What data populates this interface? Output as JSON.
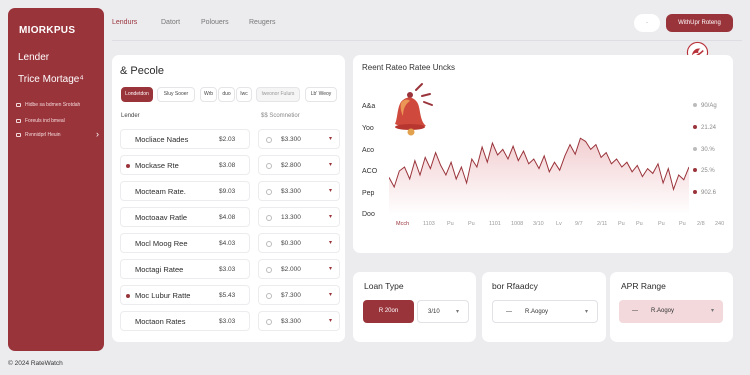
{
  "app": {
    "brand": "MIORKPUS",
    "footer": "© 2024 RateWatch"
  },
  "nav": {
    "tabs": [
      {
        "label": "Lendurs",
        "active": true
      },
      {
        "label": "Datort"
      },
      {
        "label": "Polouers"
      },
      {
        "label": "Reugers"
      }
    ],
    "toggle_label": "·",
    "cta_label": "WithUpr Roteng"
  },
  "sidebar": {
    "title": "Lender",
    "subtitle": "Trice Mortage⁴",
    "items": [
      {
        "icon": "list-icon",
        "label": "Hidbe sa bdmen Srotdah"
      },
      {
        "icon": "wifi-icon",
        "label": "Foreuls ind bmeal"
      },
      {
        "icon": "card-icon",
        "label": "Rvnnidprl Heuin"
      }
    ]
  },
  "lenders": {
    "title": "& Pecole",
    "filters": [
      "Londetdon",
      "Sluy Sooer",
      "Wrb",
      "duo",
      "Iwc",
      "lweonor Fulurs",
      "Lb' Weoy"
    ],
    "col_lender": "Lender",
    "col_amount": "$$ Scomnetior",
    "rows": [
      {
        "name": "Mocliace Nades",
        "rate": "$2.03",
        "amount": "$3.300",
        "dot": false
      },
      {
        "name": "Mockase Rte",
        "rate": "$3.08",
        "amount": "$2.800",
        "dot": true
      },
      {
        "name": "Mocteam Rate.",
        "rate": "$9.03",
        "amount": "$3.300",
        "dot": false
      },
      {
        "name": "Moctoaav Ratle",
        "rate": "$4.08",
        "amount": "13.300",
        "dot": false
      },
      {
        "name": "Mocl Moog Ree",
        "rate": "$4.03",
        "amount": "$0.300",
        "dot": false
      },
      {
        "name": "Moctagi Ratee",
        "rate": "$3.03",
        "amount": "$2.000",
        "dot": false
      },
      {
        "name": "Moc Lubur Ratte",
        "rate": "$5.43",
        "amount": "$7.300",
        "dot": true
      },
      {
        "name": "Moctaon Rates",
        "rate": "$3.03",
        "amount": "$3.300",
        "dot": false
      }
    ]
  },
  "chart_data": {
    "type": "line",
    "title": "Reent Rateo Ratee Uncks",
    "y_labels": [
      "A&a",
      "Yoo",
      "Aco",
      "ACO",
      "Pep",
      "Doo"
    ],
    "x": [
      "Mcch",
      "1103",
      "Pu",
      "Pu",
      "1101",
      "1008",
      "3/10",
      "Lv",
      "9/7",
      "2/11",
      "Pu",
      "Pu",
      "Pu",
      "Pu",
      "2/8",
      "240"
    ],
    "legend": [
      {
        "label": "90/Ag",
        "color": "#bbbbbb"
      },
      {
        "label": "21.24",
        "color": "#9a343b"
      },
      {
        "label": "30.%",
        "color": "#bbbbbb"
      },
      {
        "label": "25.%",
        "color": "#9a343b"
      },
      {
        "label": "902.6",
        "color": "#9a343b"
      }
    ],
    "series": [
      {
        "values": [
          0.47,
          0.35,
          0.55,
          0.6,
          0.45,
          0.68,
          0.5,
          0.72,
          0.58,
          0.78,
          0.62,
          0.5,
          0.66,
          0.45,
          0.6,
          0.4,
          0.7,
          0.6,
          0.85,
          0.66,
          0.9,
          0.75,
          0.82,
          0.7,
          0.86,
          0.68,
          0.8,
          0.64,
          0.7,
          0.58,
          0.74,
          0.54,
          0.66,
          0.56,
          0.74,
          0.88,
          0.76,
          0.96,
          0.92,
          0.82,
          0.88,
          0.72,
          0.78,
          0.64,
          0.7,
          0.6,
          0.66,
          0.54,
          0.62,
          0.48,
          0.58,
          0.52,
          0.64,
          0.4,
          0.58,
          0.32,
          0.5,
          0.44,
          0.6
        ]
      }
    ],
    "ylim": [
      0,
      1
    ]
  },
  "loan": {
    "title": "Loan Type",
    "option1": "R 20on",
    "option2": "3/10"
  },
  "ready": {
    "title": "bor Rfaadcy",
    "option": "R.Aogoy"
  },
  "apr": {
    "title": "APR Range",
    "option": "R.Aogoy"
  }
}
